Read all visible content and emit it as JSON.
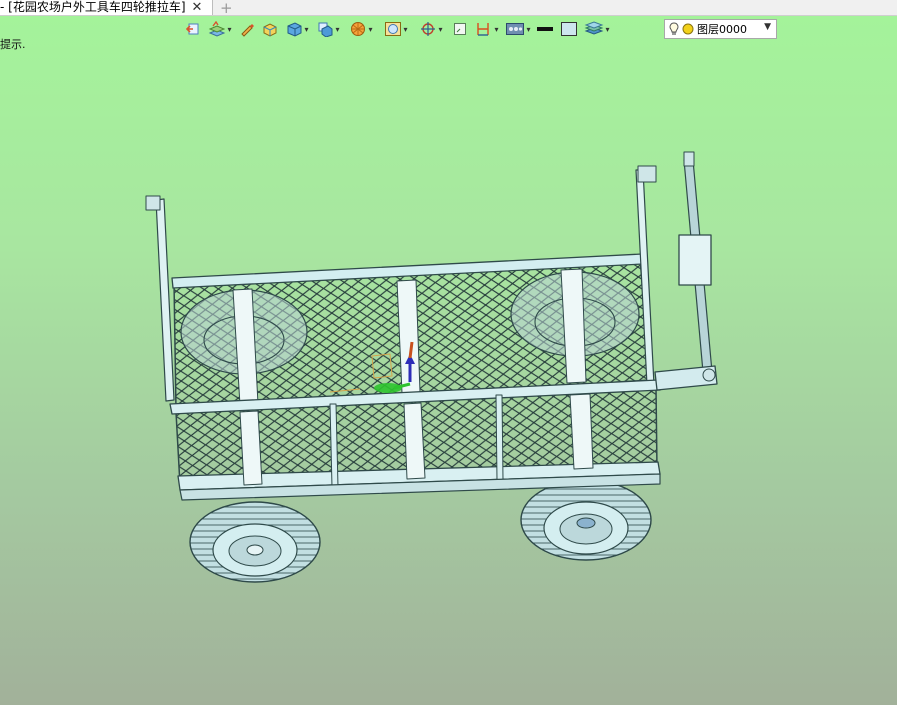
{
  "tab": {
    "title": "- [花园农场户外工具车四轮推拉车]",
    "close_glyph": "✕",
    "add_glyph": "+"
  },
  "hint": {
    "text": "提示."
  },
  "toolbar": {
    "icons": [
      "view-fit-icon",
      "layer-style-icon",
      "pen-tool-icon",
      "box-solid-icon",
      "cube-icon",
      "view-cube-icon",
      "render-style-icon",
      "display-mode-icon",
      "orient-icon",
      "frame-icon",
      "dimension-icon",
      "scene-icon",
      "line-color-icon",
      "fill-color-icon",
      "layer-stack-icon"
    ],
    "layer": {
      "name": "图层0000"
    }
  },
  "colors": {
    "bg_top": "#a4f49a",
    "bg_bottom": "#a2b19a",
    "model_stroke": "#2f4a4a",
    "model_fill": "#c8e4e6"
  }
}
